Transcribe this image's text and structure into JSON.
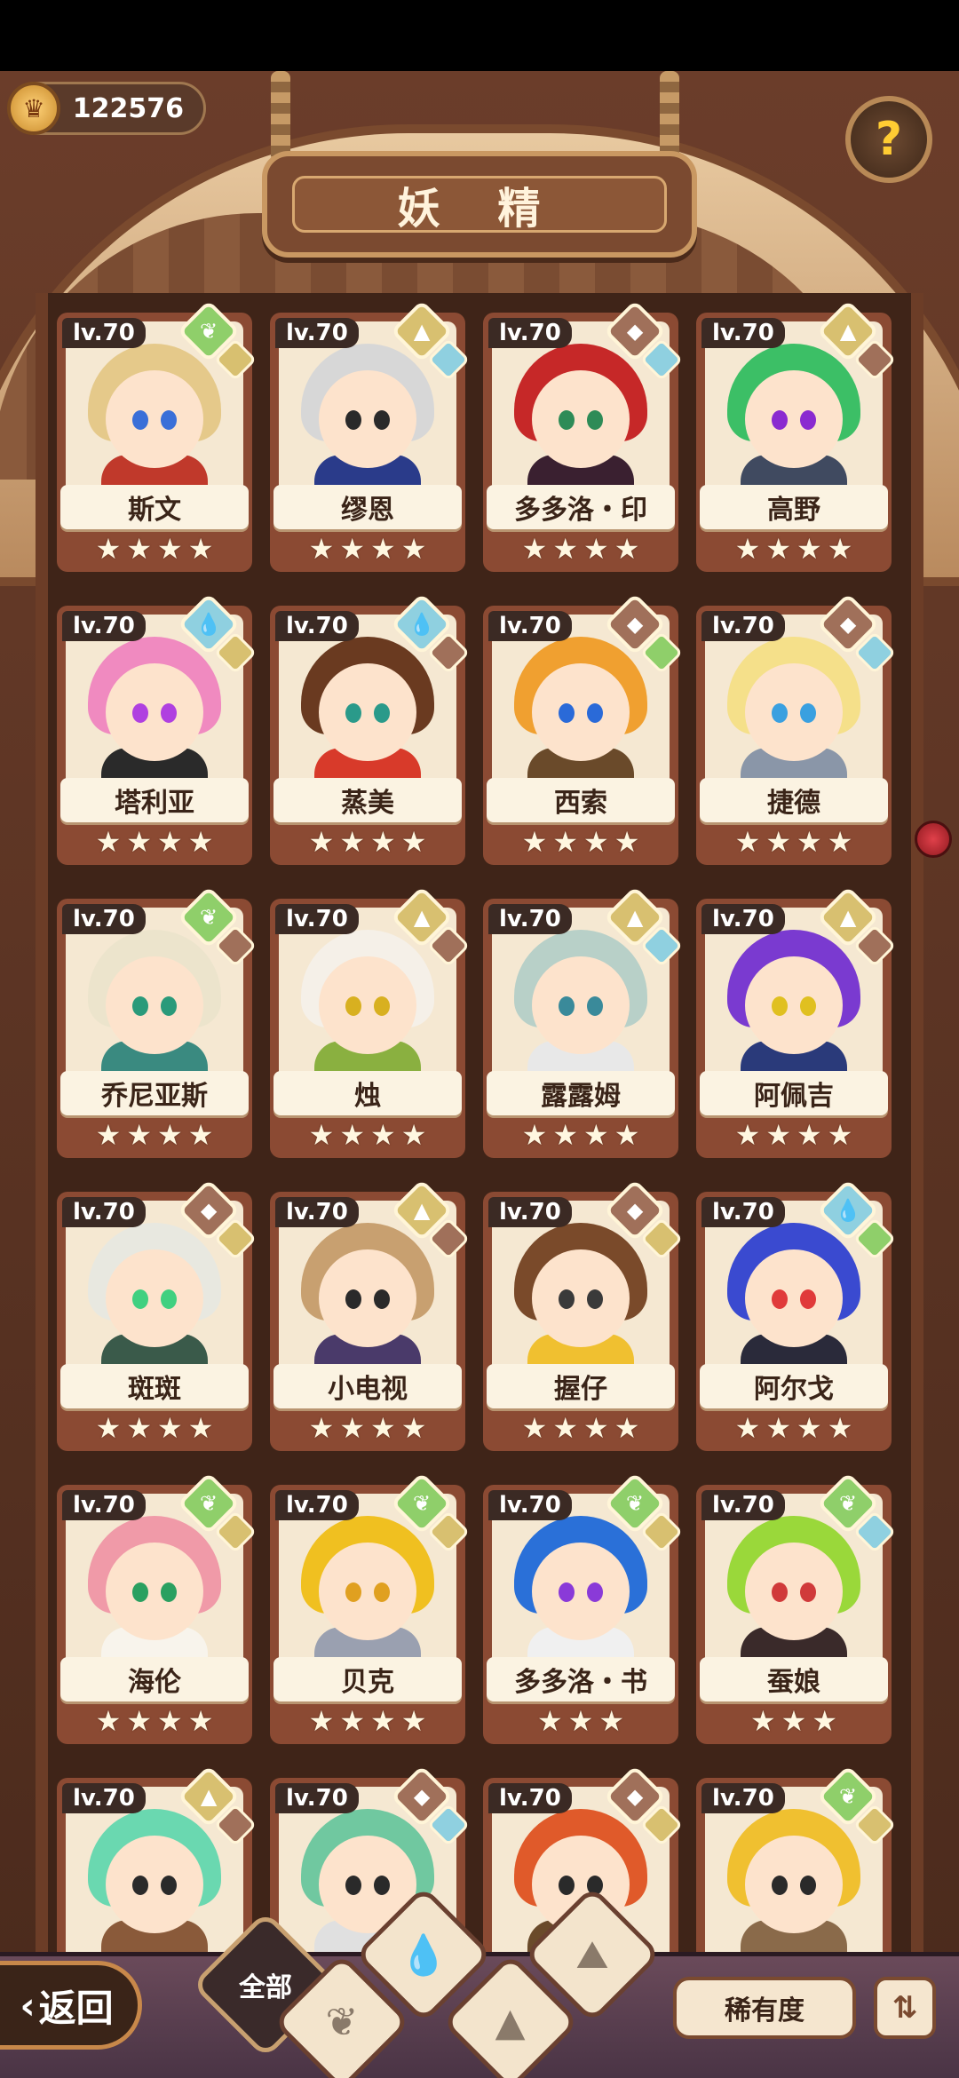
{
  "header": {
    "title": "妖 精",
    "coins": "122576",
    "help_icon": "question-sprout-icon"
  },
  "cards": [
    {
      "level": "lv.70",
      "name": "斯文",
      "stars": 4,
      "hair": "#e5c98a",
      "body": "#c0392b",
      "eye": "#3a6fd8",
      "badge1": "#8fcf6a",
      "badge1_icon": "sprout",
      "badge2": "#d8c070"
    },
    {
      "level": "lv.70",
      "name": "缪恩",
      "stars": 4,
      "hair": "#d7d7d7",
      "body": "#2a3b8a",
      "eye": "#2a2a2a",
      "badge1": "#d8c070",
      "badge1_icon": "mountain",
      "badge2": "#8fd0e0"
    },
    {
      "level": "lv.70",
      "name": "多多洛・印",
      "stars": 4,
      "hair": "#c62828",
      "body": "#3a2030",
      "eye": "#2e8b57",
      "badge1": "#a0705a",
      "badge1_icon": "rock",
      "badge2": "#8fd0e0"
    },
    {
      "level": "lv.70",
      "name": "高野",
      "stars": 4,
      "hair": "#3cbf66",
      "body": "#404a60",
      "eye": "#8a2ad0",
      "badge1": "#d8c070",
      "badge1_icon": "mountain",
      "badge2": "#a0705a"
    },
    {
      "level": "lv.70",
      "name": "塔利亚",
      "stars": 4,
      "hair": "#f08ac0",
      "body": "#2a2a2a",
      "eye": "#b040e0",
      "badge1": "#8fd0e0",
      "badge1_icon": "water",
      "badge2": "#d8c070"
    },
    {
      "level": "lv.70",
      "name": "蒸美",
      "stars": 4,
      "hair": "#6a3a20",
      "body": "#d83a2a",
      "eye": "#2a9a8a",
      "badge1": "#8fd0e0",
      "badge1_icon": "water",
      "badge2": "#a0705a"
    },
    {
      "level": "lv.70",
      "name": "西索",
      "stars": 4,
      "hair": "#f0a030",
      "body": "#6a4a2a",
      "eye": "#2a6ad8",
      "badge1": "#a0705a",
      "badge1_icon": "rock",
      "badge2": "#8fcf6a"
    },
    {
      "level": "lv.70",
      "name": "捷德",
      "stars": 4,
      "hair": "#f5e08a",
      "body": "#8a96a8",
      "eye": "#3aa0e0",
      "badge1": "#a0705a",
      "badge1_icon": "rock",
      "badge2": "#8fd0e0"
    },
    {
      "level": "lv.70",
      "name": "乔尼亚斯",
      "stars": 4,
      "hair": "#ece4cc",
      "body": "#3a8a80",
      "eye": "#2a9a7a",
      "badge1": "#8fcf6a",
      "badge1_icon": "sprout",
      "badge2": "#a0705a"
    },
    {
      "level": "lv.70",
      "name": "烛",
      "stars": 4,
      "hair": "#f5f0e8",
      "body": "#8ab040",
      "eye": "#d8b020",
      "badge1": "#d8c070",
      "badge1_icon": "mountain",
      "badge2": "#a0705a"
    },
    {
      "level": "lv.70",
      "name": "露露姆",
      "stars": 4,
      "hair": "#b8d0c8",
      "body": "#e8e8e8",
      "eye": "#3a8a9a",
      "badge1": "#d8c070",
      "badge1_icon": "mountain",
      "badge2": "#8fd0e0"
    },
    {
      "level": "lv.70",
      "name": "阿佩吉",
      "stars": 4,
      "hair": "#7a3ad0",
      "body": "#2a3a7a",
      "eye": "#e0c020",
      "badge1": "#d8c070",
      "badge1_icon": "mountain",
      "badge2": "#a0705a"
    },
    {
      "level": "lv.70",
      "name": "斑斑",
      "stars": 4,
      "hair": "#e8e8e0",
      "body": "#3a5a4a",
      "eye": "#40d080",
      "badge1": "#a0705a",
      "badge1_icon": "rock",
      "badge2": "#d8c070"
    },
    {
      "level": "lv.70",
      "name": "小电视",
      "stars": 4,
      "hair": "#c8a070",
      "body": "#4a3a6a",
      "eye": "#2a2a2a",
      "badge1": "#d8c070",
      "badge1_icon": "mountain",
      "badge2": "#a0705a"
    },
    {
      "level": "lv.70",
      "name": "握仔",
      "stars": 4,
      "hair": "#7a4a2a",
      "body": "#f0c030",
      "eye": "#3a3a3a",
      "badge1": "#a0705a",
      "badge1_icon": "rock",
      "badge2": "#d8c070"
    },
    {
      "level": "lv.70",
      "name": "阿尔戈",
      "stars": 4,
      "hair": "#3a4ad0",
      "body": "#2a2a3a",
      "eye": "#e03a3a",
      "badge1": "#8fd0e0",
      "badge1_icon": "water",
      "badge2": "#8fcf6a"
    },
    {
      "level": "lv.70",
      "name": "海伦",
      "stars": 4,
      "hair": "#f09aa8",
      "body": "#f8f4ec",
      "eye": "#2aa060",
      "badge1": "#8fcf6a",
      "badge1_icon": "sprout",
      "badge2": "#d8c070"
    },
    {
      "level": "lv.70",
      "name": "贝克",
      "stars": 4,
      "hair": "#f0c020",
      "body": "#9aa0b0",
      "eye": "#e0a020",
      "badge1": "#8fcf6a",
      "badge1_icon": "sprout",
      "badge2": "#d8c070"
    },
    {
      "level": "lv.70",
      "name": "多多洛・书",
      "stars": 3,
      "hair": "#2a70d8",
      "body": "#f0f0f0",
      "eye": "#8a3ad8",
      "badge1": "#8fcf6a",
      "badge1_icon": "sprout",
      "badge2": "#d8c070"
    },
    {
      "level": "lv.70",
      "name": "蚕娘",
      "stars": 3,
      "hair": "#9ad83a",
      "body": "#3a2a2a",
      "eye": "#d03a3a",
      "badge1": "#8fcf6a",
      "badge1_icon": "sprout",
      "badge2": "#8fd0e0"
    },
    {
      "level": "lv.70",
      "name": "",
      "stars": 0,
      "hair": "#6ad8b0",
      "body": "#8a5a3a",
      "eye": "#2a2a2a",
      "badge1": "#d8c070",
      "badge1_icon": "mountain",
      "badge2": "#a0705a"
    },
    {
      "level": "lv.70",
      "name": "",
      "stars": 0,
      "hair": "#70c8a0",
      "body": "#e0e0e0",
      "eye": "#2a2a2a",
      "badge1": "#a0705a",
      "badge1_icon": "rock",
      "badge2": "#8fd0e0"
    },
    {
      "level": "lv.70",
      "name": "",
      "stars": 0,
      "hair": "#e05a2a",
      "body": "#6a4a2a",
      "eye": "#2a2a2a",
      "badge1": "#a0705a",
      "badge1_icon": "rock",
      "badge2": "#d8c070"
    },
    {
      "level": "lv.70",
      "name": "",
      "stars": 0,
      "hair": "#f0c030",
      "body": "#8a6a4a",
      "eye": "#2a2a2a",
      "badge1": "#8fcf6a",
      "badge1_icon": "sprout",
      "badge2": "#d8c070"
    }
  ],
  "bottom": {
    "back_label": "返回",
    "filter_all_label": "全部",
    "filter_icons": [
      "water-drop-icon",
      "sprout-icon",
      "mountain-icon",
      "rock-icon"
    ],
    "rarity_label": "稀有度",
    "sort_icon": "sort-order-icon"
  }
}
